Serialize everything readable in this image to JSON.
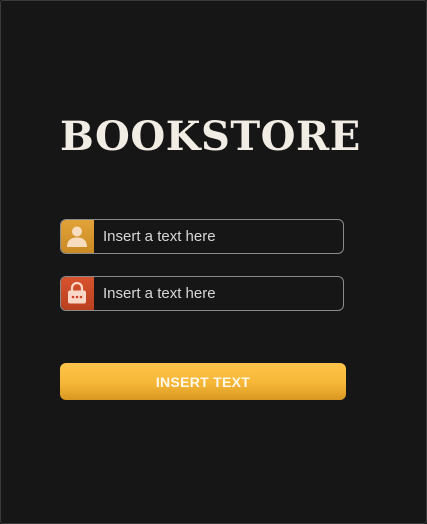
{
  "app": {
    "title": "BOOKSTORE"
  },
  "form": {
    "username": {
      "placeholder": "Insert a text here",
      "value": "",
      "icon": "user-icon"
    },
    "password": {
      "placeholder": "Insert a text here",
      "value": "",
      "icon": "lock-icon"
    },
    "submit_label": "INSERT TEXT"
  },
  "colors": {
    "background": "#161616",
    "title": "#f1ece4",
    "accent": "#f6b737",
    "user_icon_bg": "#e2a33a",
    "lock_icon_bg": "#d9532f",
    "field_border": "#8a8a8a"
  }
}
